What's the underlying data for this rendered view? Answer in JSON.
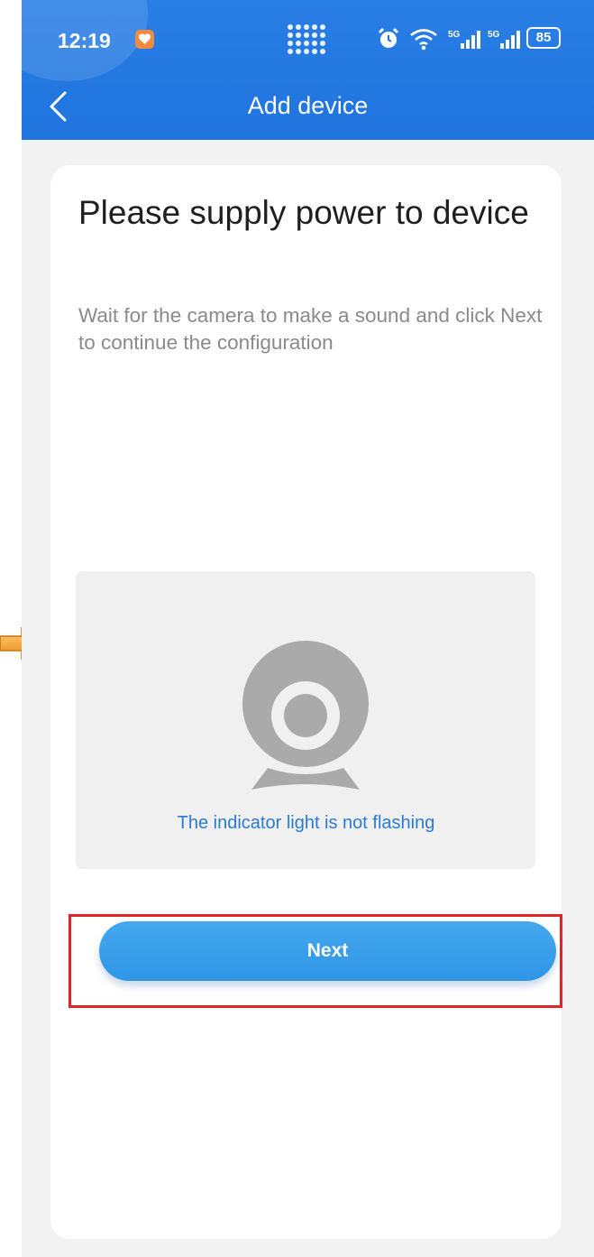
{
  "status_bar": {
    "time": "12:19",
    "battery": "85",
    "icons": [
      "heart-app-icon",
      "dots-icon",
      "alarm-icon",
      "wifi-icon",
      "signal-5g-icon",
      "signal-5g-icon",
      "battery-icon"
    ]
  },
  "nav": {
    "title": "Add device",
    "back_icon": "chevron-left-icon"
  },
  "card": {
    "heading": "Please supply power to device",
    "subtext": "Wait for the camera to make a sound and click Next to continue the configuration",
    "illustration_icon": "webcam-icon",
    "help_link": "The indicator light is not flashing",
    "next_label": "Next"
  },
  "colors": {
    "header_blue": "#1f74dd",
    "button_blue": "#3a9fe9",
    "link_blue": "#2b7ad3",
    "highlight_red": "#e0252b",
    "arrow_orange": "#f39a2c"
  }
}
